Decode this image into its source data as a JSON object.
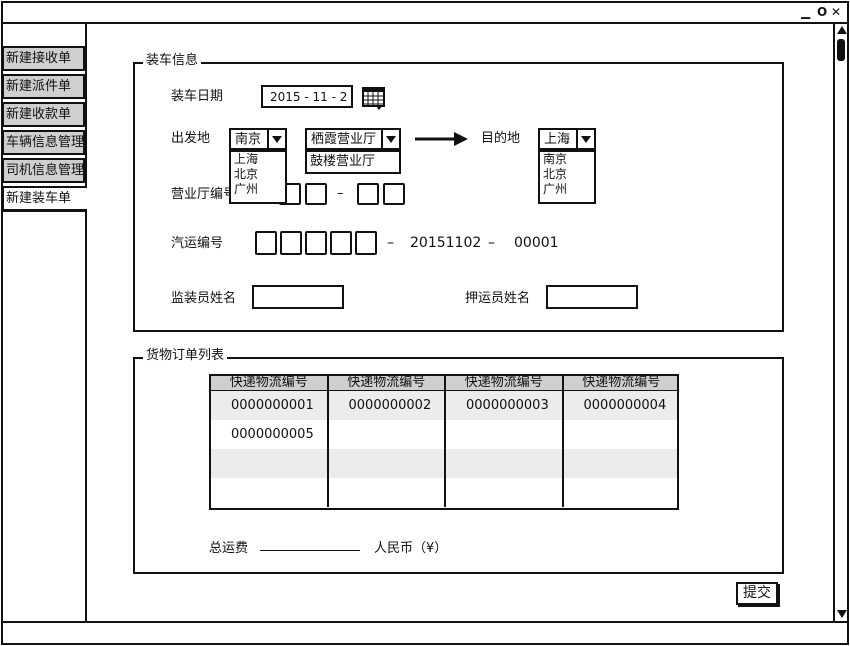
{
  "window": {
    "controls": [
      "▁",
      "O",
      "✕"
    ]
  },
  "tabs": [
    {
      "label": "新建接收单",
      "active": false
    },
    {
      "label": "新建派件单",
      "active": false
    },
    {
      "label": "新建收款单",
      "active": false
    },
    {
      "label": "车辆信息管理",
      "active": false
    },
    {
      "label": "司机信息管理",
      "active": false
    },
    {
      "label": "新建装车单",
      "active": true
    }
  ],
  "loading_info": {
    "legend": "装车信息",
    "date_label": "装车日期",
    "date_value": "2015 - 11 - 2",
    "origin_label": "出发地",
    "origin_city": "南京",
    "origin_city_options": [
      "上海",
      "北京",
      "广州"
    ],
    "origin_hall": "栖霞营业厅",
    "origin_hall_options": [
      "鼓楼营业厅"
    ],
    "destination_label": "目的地",
    "destination_city": "上海",
    "destination_city_options": [
      "南京",
      "北京",
      "广州"
    ],
    "hall_code_label": "营业厅编号",
    "hall_code_separator": "–",
    "transport_code_label": "汽运编号",
    "transport_code_sep1": "–",
    "transport_code_date": "20151102",
    "transport_code_sep2": "–",
    "transport_code_serial": "00001",
    "supervisor_label": "监装员姓名",
    "supervisor_value": "",
    "escort_label": "押运员姓名",
    "escort_value": ""
  },
  "orders": {
    "legend": "货物订单列表",
    "columns": [
      "快递物流编号",
      "快递物流编号",
      "快递物流编号",
      "快递物流编号"
    ],
    "rows": [
      [
        "0000000001",
        "0000000002",
        "0000000003",
        "0000000004"
      ],
      [
        "0000000005",
        "",
        "",
        ""
      ],
      [
        "",
        "",
        "",
        ""
      ],
      [
        "",
        "",
        "",
        ""
      ]
    ],
    "total_label": "总运费",
    "total_value": "",
    "currency": "人民币（¥）"
  },
  "submit_label": "提交"
}
